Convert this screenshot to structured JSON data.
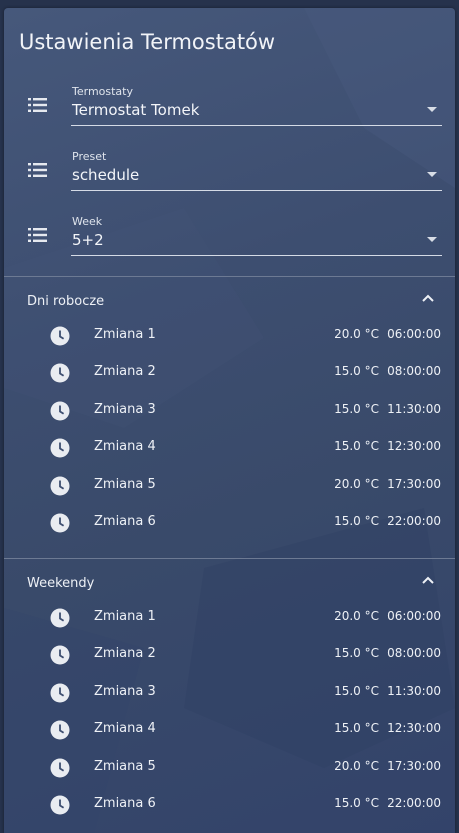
{
  "card": {
    "title": "Ustawienia Termostatów"
  },
  "selects": [
    {
      "label": "Termostaty",
      "value": "Termostat Tomek",
      "icon": "list-icon"
    },
    {
      "label": "Preset",
      "value": "schedule",
      "icon": "list-icon"
    },
    {
      "label": "Week",
      "value": "5+2",
      "icon": "list-icon"
    }
  ],
  "sections": [
    {
      "title": "Dni robocze",
      "shifts": [
        {
          "name": "Zmiana 1",
          "temp": "20.0 °C",
          "time": "06:00:00"
        },
        {
          "name": "Zmiana 2",
          "temp": "15.0 °C",
          "time": "08:00:00"
        },
        {
          "name": "Zmiana 3",
          "temp": "15.0 °C",
          "time": "11:30:00"
        },
        {
          "name": "Zmiana 4",
          "temp": "15.0 °C",
          "time": "12:30:00"
        },
        {
          "name": "Zmiana 5",
          "temp": "20.0 °C",
          "time": "17:30:00"
        },
        {
          "name": "Zmiana 6",
          "temp": "15.0 °C",
          "time": "22:00:00"
        }
      ]
    },
    {
      "title": "Weekendy",
      "shifts": [
        {
          "name": "Zmiana 1",
          "temp": "20.0 °C",
          "time": "06:00:00"
        },
        {
          "name": "Zmiana 2",
          "temp": "15.0 °C",
          "time": "08:00:00"
        },
        {
          "name": "Zmiana 3",
          "temp": "15.0 °C",
          "time": "11:30:00"
        },
        {
          "name": "Zmiana 4",
          "temp": "15.0 °C",
          "time": "12:30:00"
        },
        {
          "name": "Zmiana 5",
          "temp": "20.0 °C",
          "time": "17:30:00"
        },
        {
          "name": "Zmiana 6",
          "temp": "15.0 °C",
          "time": "22:00:00"
        }
      ]
    }
  ],
  "colors": {
    "background": "#26324c",
    "card": "#3d4e70",
    "text": "#eef1f6",
    "icon": "#e6e9ef"
  }
}
